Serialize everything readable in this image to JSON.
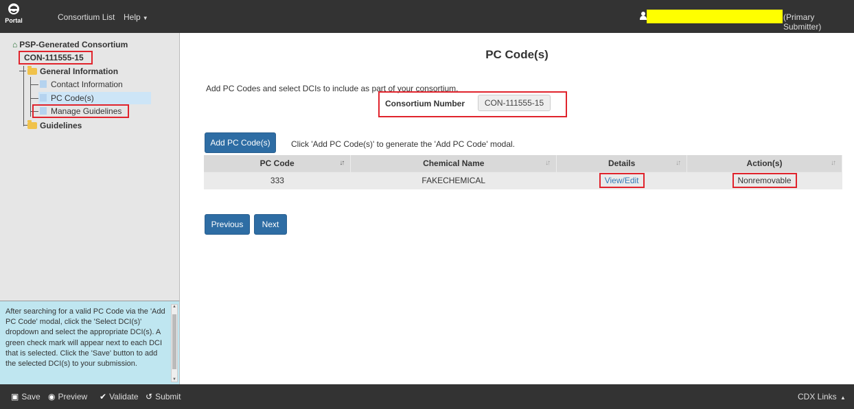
{
  "topbar": {
    "logo_label": "Portal",
    "nav": [
      {
        "label": "Consortium List"
      },
      {
        "label": "Help"
      }
    ],
    "user_role": "(Primary Submitter)"
  },
  "sidebar": {
    "root_label": "PSP-Generated Consortium",
    "consortium_id": "CON-111555-15",
    "general_info_label": "General Information",
    "items": [
      {
        "label": "Contact Information"
      },
      {
        "label": "PC Code(s)"
      },
      {
        "label": "Manage Guidelines"
      }
    ],
    "guidelines_label": "Guidelines"
  },
  "help": {
    "text": "After searching for a valid PC Code via the 'Add PC Code' modal, click the 'Select DCI(s)' dropdown and select the appropriate DCI(s). A green check mark will appear next to each DCI that is selected. Click the 'Save' button to add the selected DCI(s) to your submission."
  },
  "main": {
    "title": "PC Code(s)",
    "intro": "Add PC Codes and select DCIs to include as part of your consortium.",
    "consortium_number_label": "Consortium Number",
    "consortium_number_value": "CON-111555-15",
    "add_button_label": "Add PC Code(s)",
    "add_hint": "Click 'Add PC Code(s)' to generate the 'Add PC Code' modal.",
    "table": {
      "headers": [
        "PC Code",
        "Chemical Name",
        "Details",
        "Action(s)"
      ],
      "rows": [
        {
          "pc_code": "333",
          "chemical_name": "FAKECHEMICAL",
          "details": "View/Edit",
          "action": "Nonremovable"
        }
      ]
    },
    "previous_label": "Previous",
    "next_label": "Next"
  },
  "bottombar": {
    "save_label": "Save",
    "preview_label": "Preview",
    "validate_label": "Validate",
    "submit_label": "Submit",
    "cdx_links_label": "CDX Links"
  },
  "colors": {
    "navbar": "#333333",
    "primary_button": "#2e6da4",
    "highlight_red": "#e0222b",
    "redaction_yellow": "#ffff00",
    "help_background": "#bfe6f0"
  }
}
